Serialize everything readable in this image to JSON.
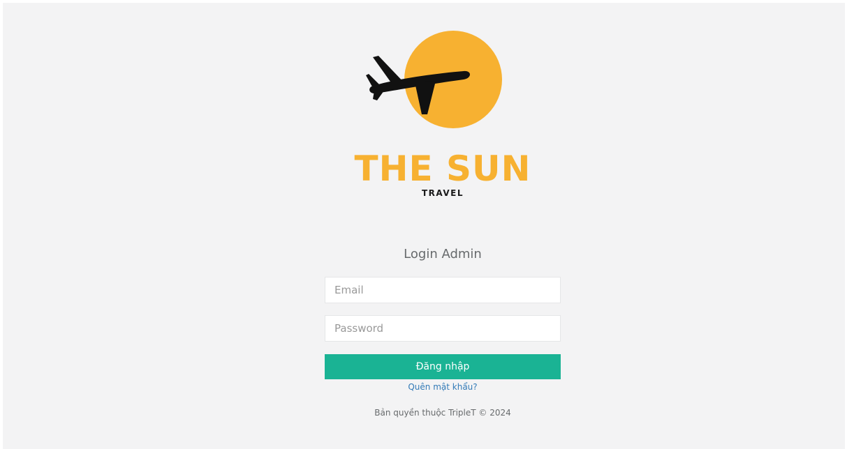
{
  "brand": {
    "title": "THE SUN",
    "subtitle": "TRAVEL",
    "sun_color": "#f7b131",
    "plane_color": "#111111"
  },
  "login": {
    "title": "Login Admin",
    "email_placeholder": "Email",
    "password_placeholder": "Password",
    "submit_label": "Đăng nhập",
    "forgot_label": "Quên mật khẩu?",
    "accent_color": "#1ab394"
  },
  "footer": {
    "copyright": "Bản quyền thuộc TripleT © 2024"
  }
}
